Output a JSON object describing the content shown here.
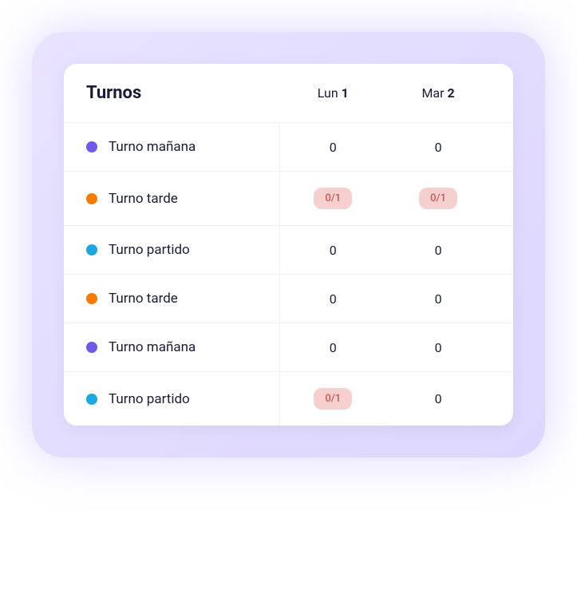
{
  "header": {
    "title": "Turnos",
    "days": [
      {
        "label": "Lun",
        "num": "1"
      },
      {
        "label": "Mar",
        "num": "2"
      }
    ]
  },
  "colors": {
    "purple": "#6d5ae8",
    "orange": "#f57c00",
    "blue": "#1ba8e0"
  },
  "rows": [
    {
      "label": "Turno mañana",
      "color": "#6d5ae8",
      "values": [
        {
          "text": "0",
          "badge": false
        },
        {
          "text": "0",
          "badge": false
        }
      ]
    },
    {
      "label": "Turno tarde",
      "color": "#f57c00",
      "values": [
        {
          "text": "0/1",
          "badge": true
        },
        {
          "text": "0/1",
          "badge": true
        }
      ]
    },
    {
      "label": "Turno partido",
      "color": "#1ba8e0",
      "values": [
        {
          "text": "0",
          "badge": false
        },
        {
          "text": "0",
          "badge": false
        }
      ]
    },
    {
      "label": "Turno tarde",
      "color": "#f57c00",
      "values": [
        {
          "text": "0",
          "badge": false
        },
        {
          "text": "0",
          "badge": false
        }
      ]
    },
    {
      "label": "Turno mañana",
      "color": "#6d5ae8",
      "values": [
        {
          "text": "0",
          "badge": false
        },
        {
          "text": "0",
          "badge": false
        }
      ]
    },
    {
      "label": "Turno partido",
      "color": "#1ba8e0",
      "values": [
        {
          "text": "0/1",
          "badge": true
        },
        {
          "text": "0",
          "badge": false
        }
      ]
    }
  ]
}
